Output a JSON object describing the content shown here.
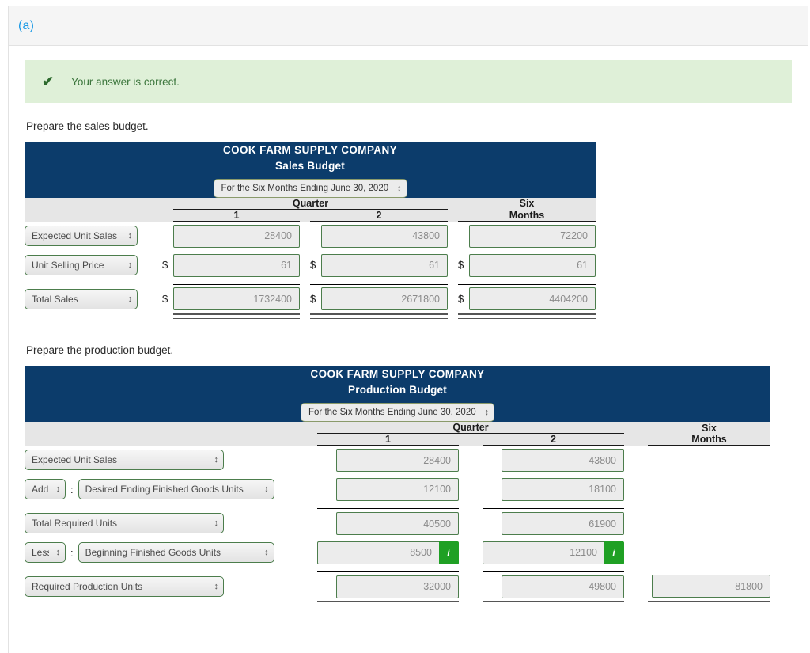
{
  "part": {
    "label": "(a)"
  },
  "alert": {
    "icon": "check-icon",
    "text": "Your answer is correct."
  },
  "instructions": {
    "sales": "Prepare the sales budget.",
    "production": "Prepare the production budget."
  },
  "colors": {
    "header_navy": "#0c3c6b",
    "alert_green_bg": "#dff0d8",
    "alert_green_text": "#3c763d",
    "badge_green": "#1fa024",
    "input_border_green": "#4c7d4c",
    "link_blue": "#1b9ae6"
  },
  "sales_budget": {
    "company": "COOK FARM SUPPLY COMPANY",
    "title": "Sales Budget",
    "period": "For the Six Months Ending June 30, 2020",
    "group_header": "Quarter",
    "columns": [
      "1",
      "2"
    ],
    "six_months_line1": "Six",
    "six_months_line2": "Months",
    "rows": [
      {
        "label": "Expected Unit Sales",
        "currency": false,
        "q1": "28400",
        "q2": "43800",
        "six": "72200"
      },
      {
        "label": "Unit Selling Price",
        "currency": true,
        "q1": "61",
        "q2": "61",
        "six": "61"
      },
      {
        "label": "Total Sales",
        "currency": true,
        "q1": "1732400",
        "q2": "2671800",
        "six": "4404200"
      }
    ],
    "currency_symbol": "$"
  },
  "production_budget": {
    "company": "COOK FARM SUPPLY COMPANY",
    "title": "Production Budget",
    "period": "For the Six Months Ending June 30, 2020",
    "group_header": "Quarter",
    "columns": [
      "1",
      "2"
    ],
    "six_months_line1": "Six",
    "six_months_line2": "Months",
    "rows": [
      {
        "prefix": "",
        "label": "Expected Unit Sales",
        "q1": "28400",
        "q2": "43800",
        "six": "",
        "badge": false
      },
      {
        "prefix": "Add",
        "label": "Desired Ending Finished Goods Units",
        "q1": "12100",
        "q2": "18100",
        "six": "",
        "badge": false
      },
      {
        "prefix": "",
        "label": "Total Required Units",
        "q1": "40500",
        "q2": "61900",
        "six": "",
        "badge": false
      },
      {
        "prefix": "Less",
        "label": "Beginning Finished Goods Units",
        "q1": "8500",
        "q2": "12100",
        "six": "",
        "badge": true
      },
      {
        "prefix": "",
        "label": "Required Production Units",
        "q1": "32000",
        "q2": "49800",
        "six": "81800",
        "badge": false
      }
    ],
    "badge_label": "i",
    "colon": ":"
  }
}
